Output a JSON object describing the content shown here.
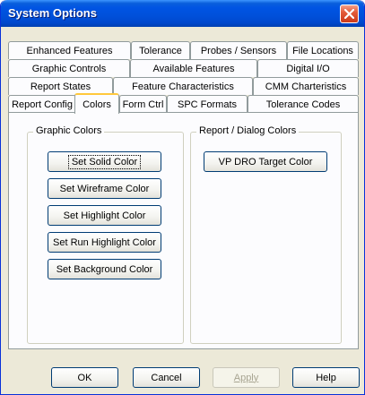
{
  "window": {
    "title": "System Options"
  },
  "tabs": {
    "row1": [
      "Enhanced Features",
      "Tolerance",
      "Probes / Sensors",
      "File Locations"
    ],
    "row2": [
      "Graphic Controls",
      "Available Features",
      "Digital I/O"
    ],
    "row3": [
      "Report States",
      "Feature Characteristics",
      "CMM Charteristics"
    ],
    "row4": [
      "Report Config",
      "Colors",
      "Form Ctrl",
      "SPC Formats",
      "Tolerance Codes"
    ],
    "active": "Colors"
  },
  "graphic_colors": {
    "title": "Graphic Colors",
    "buttons": [
      "Set Solid Color",
      "Set Wireframe Color",
      "Set Highlight Color",
      "Set Run Highlight Color",
      "Set Background Color"
    ]
  },
  "report_colors": {
    "title": "Report / Dialog Colors",
    "buttons": [
      "VP DRO Target Color"
    ]
  },
  "footer": {
    "ok": "OK",
    "cancel": "Cancel",
    "apply": "Apply",
    "help": "Help"
  },
  "colors": {
    "titlebar": "#0054e3",
    "dialog_bg": "#ece9d8",
    "active_tab_highlight": "#ffc83c",
    "close_button": "#e35b3a"
  },
  "icons": {
    "close": "close-icon"
  }
}
